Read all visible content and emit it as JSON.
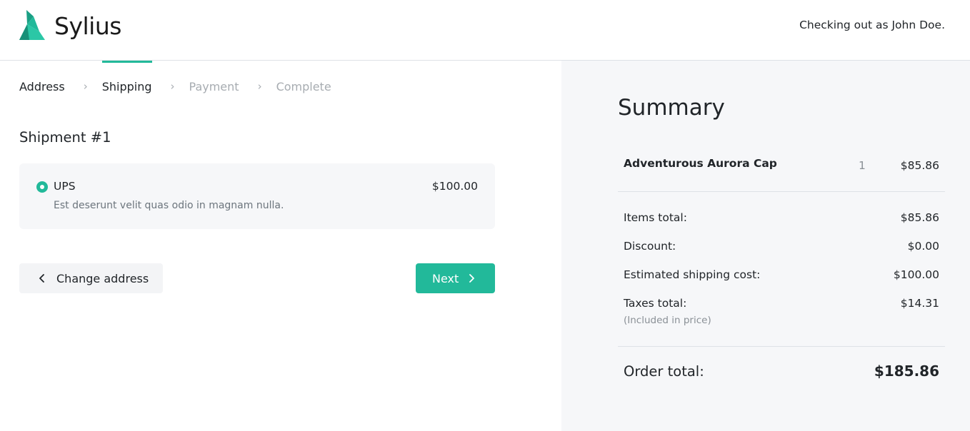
{
  "brand": {
    "name": "Sylius",
    "accent": "#22b99a"
  },
  "header": {
    "checking_out": "Checking out as John Doe."
  },
  "steps": [
    {
      "label": "Address",
      "state": "done"
    },
    {
      "label": "Shipping",
      "state": "active"
    },
    {
      "label": "Payment",
      "state": "inactive"
    },
    {
      "label": "Complete",
      "state": "inactive"
    }
  ],
  "shipment": {
    "title": "Shipment #1",
    "method": {
      "name": "UPS",
      "description": "Est deserunt velit quas odio in magnam nulla.",
      "price": "$100.00",
      "selected": true
    }
  },
  "actions": {
    "back_label": "Change address",
    "next_label": "Next"
  },
  "summary": {
    "title": "Summary",
    "item": {
      "name": "Adventurous Aurora Cap",
      "qty": "1",
      "price": "$85.86"
    },
    "items_total_label": "Items total:",
    "items_total": "$85.86",
    "discount_label": "Discount:",
    "discount": "$0.00",
    "shipping_label": "Estimated shipping cost:",
    "shipping": "$100.00",
    "taxes_label": "Taxes total:",
    "taxes": "$14.31",
    "taxes_note": "(Included in price)",
    "order_total_label": "Order total:",
    "order_total": "$185.86"
  }
}
